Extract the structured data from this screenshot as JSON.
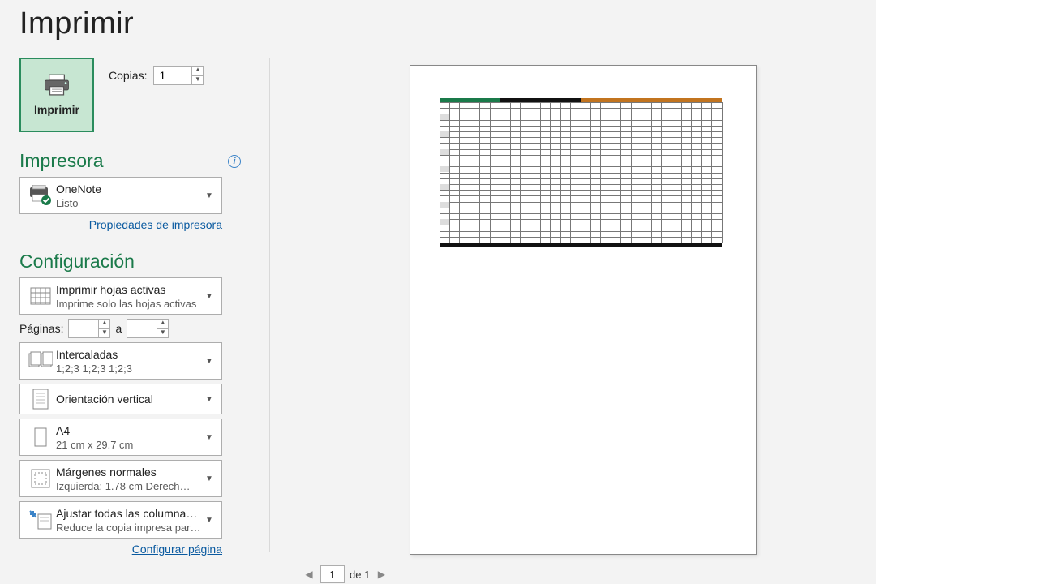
{
  "title": "Imprimir",
  "print_button_label": "Imprimir",
  "copies": {
    "label": "Copias:",
    "value": "1"
  },
  "sections": {
    "printer": "Impresora",
    "config": "Configuración"
  },
  "printer": {
    "name": "OneNote",
    "status": "Listo",
    "properties_link": "Propiedades de impresora"
  },
  "config": {
    "what": {
      "line1": "Imprimir hojas activas",
      "line2": "Imprime solo las hojas activas"
    },
    "pages": {
      "label": "Páginas:",
      "from": "",
      "to": "",
      "separator": "a"
    },
    "collate": {
      "line1": "Intercaladas",
      "line2": "1;2;3    1;2;3    1;2;3"
    },
    "orientation": {
      "line1": "Orientación vertical"
    },
    "paper": {
      "line1": "A4",
      "line2": "21 cm x 29.7 cm"
    },
    "margins": {
      "line1": "Márgenes normales",
      "line2": "Izquierda:  1.78 cm    Derech…"
    },
    "fit": {
      "line1": "Ajustar todas las columnas…",
      "line2": "Reduce la copia impresa par…"
    },
    "page_setup_link": "Configurar página"
  },
  "pager": {
    "current": "1",
    "of_label": "de 1"
  },
  "colors": {
    "accent": "#1a7a4a",
    "header_cells": [
      "#1a7a4a",
      "#1a7a4a",
      "#1a7a4a",
      "#111",
      "#111",
      "#111",
      "#111",
      "#c2741f",
      "#c2741f",
      "#c2741f",
      "#c2741f",
      "#c2741f",
      "#c2741f",
      "#c2741f"
    ]
  }
}
